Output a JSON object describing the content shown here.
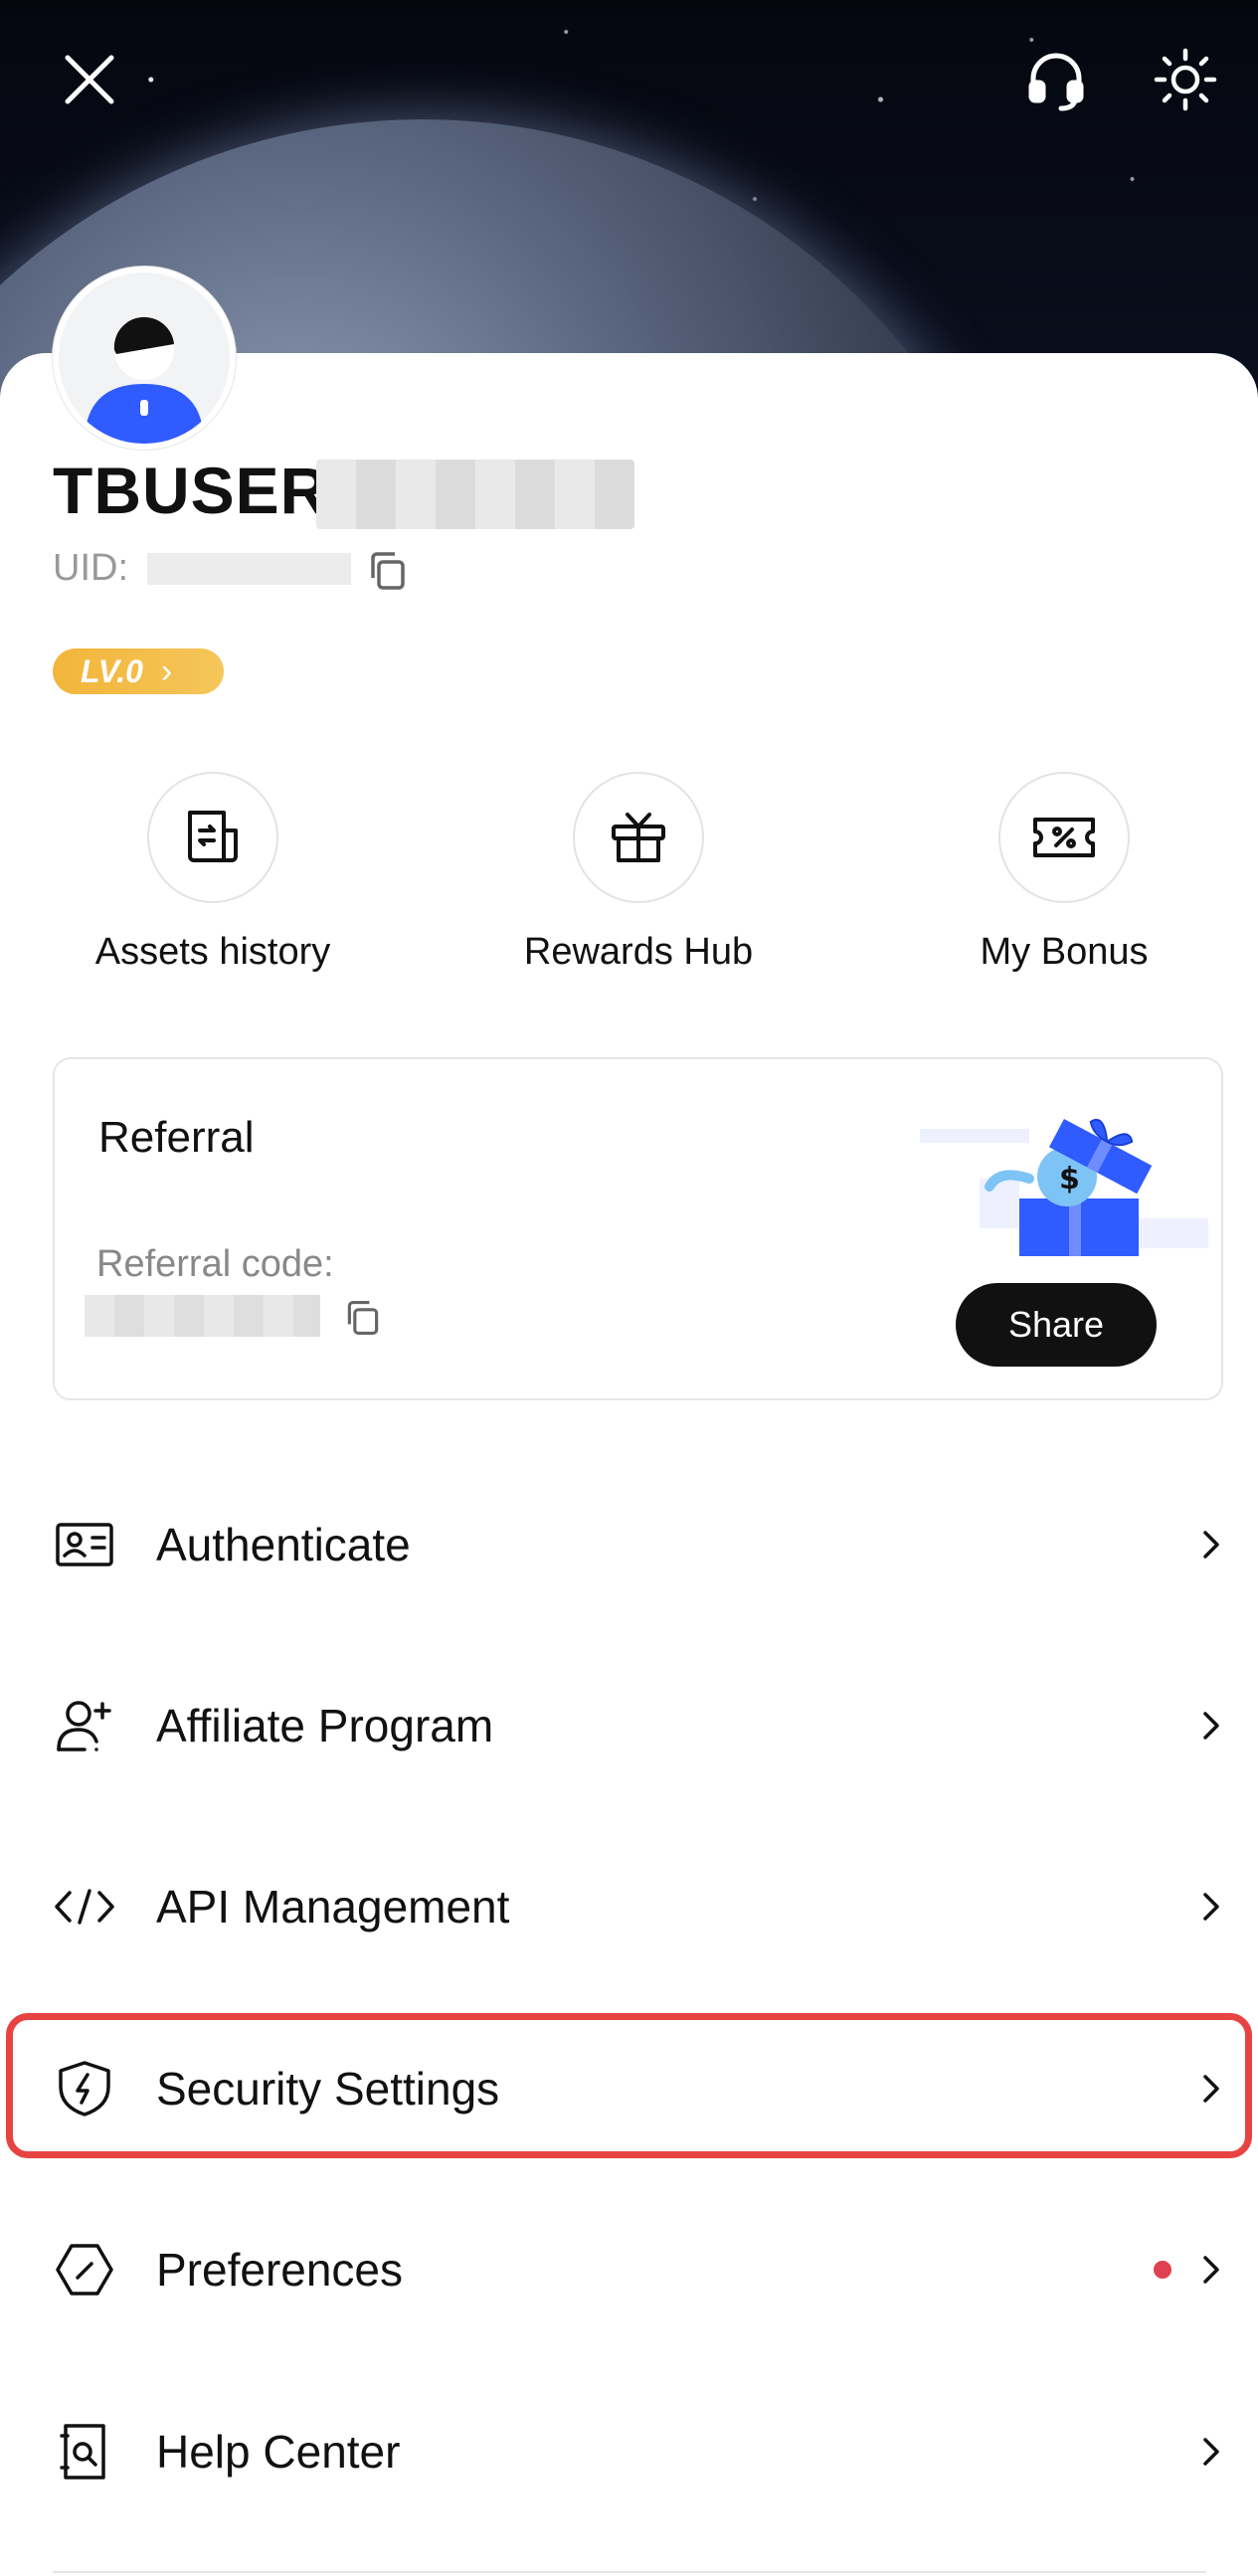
{
  "header": {
    "close_icon": "close-icon",
    "support_icon": "headset-icon",
    "theme_icon": "sun-icon"
  },
  "profile": {
    "username": "TBUSER",
    "uid_label": "UID:",
    "level": "LV.0"
  },
  "quick_actions": [
    {
      "label": "Assets history",
      "icon": "document-icon"
    },
    {
      "label": "Rewards Hub",
      "icon": "gift-icon"
    },
    {
      "label": "My Bonus",
      "icon": "coupon-icon"
    }
  ],
  "referral": {
    "title": "Referral",
    "code_label": "Referral code:",
    "share_label": "Share"
  },
  "menu": [
    {
      "label": "Authenticate",
      "icon": "id-card-icon"
    },
    {
      "label": "Affiliate Program",
      "icon": "user-plus-icon"
    },
    {
      "label": "API Management",
      "icon": "code-icon"
    },
    {
      "label": "Security Settings",
      "icon": "shield-icon"
    },
    {
      "label": "Preferences",
      "icon": "preferences-icon",
      "badge": "dot"
    },
    {
      "label": "Help Center",
      "icon": "help-icon"
    }
  ],
  "colors": {
    "accent_highlight": "#e84343",
    "level_badge": "#f2b53a",
    "brand_blue": "#2f5bff",
    "notification_dot": "#e0404f"
  }
}
